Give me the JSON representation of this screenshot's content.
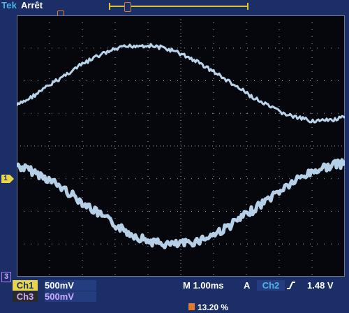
{
  "header": {
    "brand": "Tek",
    "status": "Arrêt"
  },
  "markers": {
    "ch1": "1",
    "ch3": "3",
    "trigger_position": "T"
  },
  "readouts": {
    "ch1_label": "Ch1",
    "ch1_scale": "500mV",
    "ch3_label": "Ch3",
    "ch3_scale": "500mV",
    "timebase": "M 1.00ms",
    "trigger_mode": "A",
    "trigger_source": "Ch2",
    "trigger_level": "1.48 V",
    "trigger_position": "13.20 %"
  },
  "colors": {
    "frame": "#1b2f66",
    "graticule_bg": "#05070c",
    "trace": "#c9e6ff",
    "ch1": "#e8d64a",
    "ch3": "#b57cff",
    "trigger": "#e07a2e",
    "brand": "#4fb4e6"
  }
}
